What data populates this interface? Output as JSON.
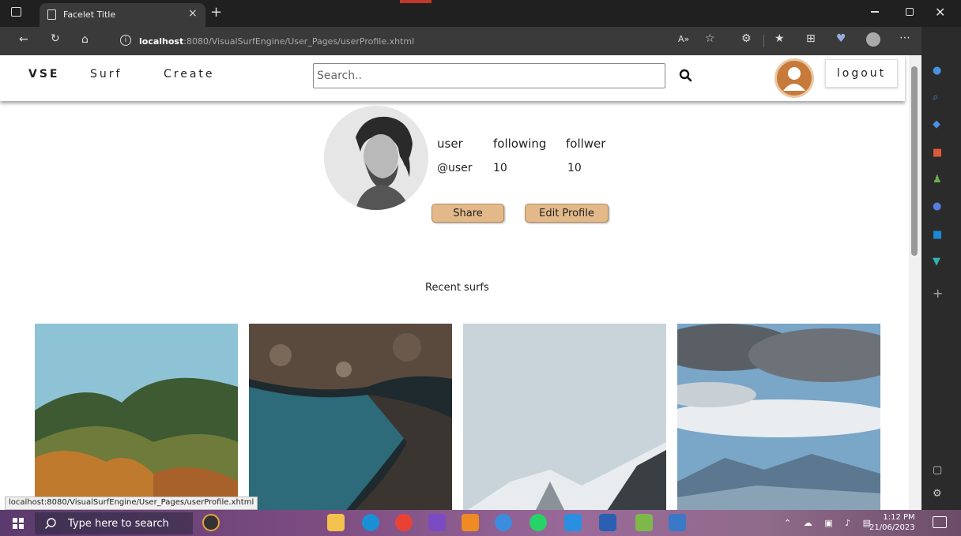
{
  "browser": {
    "tab_title": "Facelet Title",
    "new_tab_symbol": "+",
    "close_tab_symbol": "×",
    "url_host": "localhost",
    "url_rest": ":8080/VisualSurfEngine/User_Pages/userProfile.xhtml",
    "status_url": "localhost:8080/VisualSurfEngine/User_Pages/userProfile.xhtml"
  },
  "site_nav": {
    "brand": "VSE",
    "surf": "Surf",
    "create": "Create",
    "search_placeholder": "Search..",
    "logout": "logout"
  },
  "profile": {
    "name_label": "user",
    "handle": "@user",
    "following_label": "following",
    "following_count": "10",
    "follower_label": "follwer",
    "follower_count": "10",
    "share_label": "Share",
    "edit_label": "Edit Profile"
  },
  "recent": {
    "title": "Recent surfs",
    "photos": [
      {
        "icon": "mountain-forest-photo"
      },
      {
        "icon": "river-rocks-photo"
      },
      {
        "icon": "snowy-peak-photo"
      },
      {
        "icon": "cloudy-mountains-photo"
      }
    ]
  },
  "taskbar": {
    "search_placeholder": "Type here to search",
    "time": "1:12 PM",
    "date": "21/06/2023"
  }
}
